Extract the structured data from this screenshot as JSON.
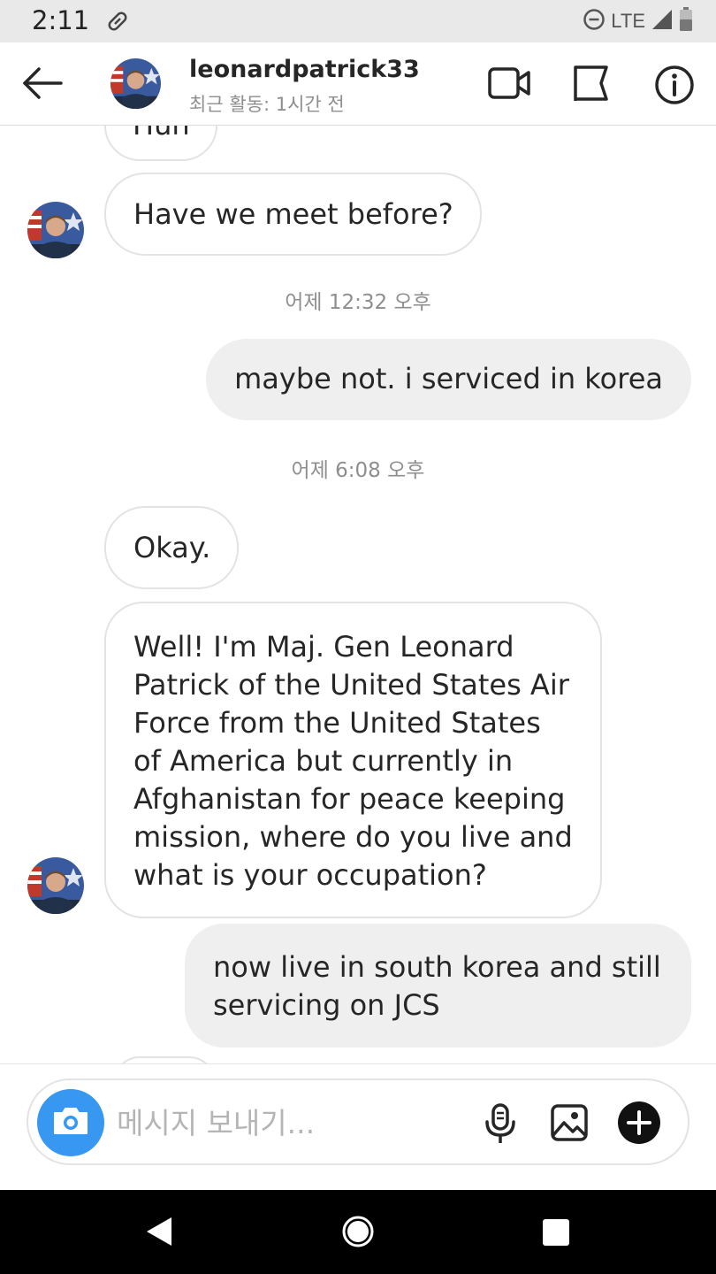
{
  "status_bar": {
    "time": "2:11",
    "network": "LTE",
    "icons": [
      "attachment-icon",
      "do-not-disturb-icon",
      "signal-icon",
      "battery-icon"
    ]
  },
  "header": {
    "username": "leonardpatrick33",
    "activity": "최근 활동: 1시간 전",
    "icons": [
      "back-arrow-icon",
      "video-call-icon",
      "flag-icon",
      "info-icon"
    ]
  },
  "messages": {
    "partial_top": "Huh",
    "m1": "Have we meet before?",
    "ts1": "어제 12:32 오후",
    "m2": "maybe not. i serviced in korea",
    "ts2": "어제 6:08 오후",
    "m3": "Okay.",
    "m4_lines": [
      "Well! I'm Maj. Gen Leonard",
      "Patrick of the United States Air",
      "Force from the United States",
      "of America but currently in",
      "Afghanistan for peace keeping",
      "mission, where do you live and",
      "what is your occupation?"
    ],
    "m5_lines": [
      "now live in south korea and still",
      "servicing on JCS"
    ]
  },
  "composer": {
    "placeholder": "메시지 보내기...",
    "icons": [
      "camera-icon",
      "microphone-icon",
      "gallery-icon",
      "add-icon"
    ]
  },
  "navigation": {
    "icons": [
      "nav-back-icon",
      "nav-home-icon",
      "nav-recents-icon"
    ]
  },
  "colors": {
    "accent": "#3897f0",
    "incoming_border": "#e3e3e3",
    "outgoing_bg": "#efefef",
    "timestamp": "#8e8e8e",
    "status_bar_bg": "#e9e9e9",
    "nav_bar_bg": "#000000"
  }
}
